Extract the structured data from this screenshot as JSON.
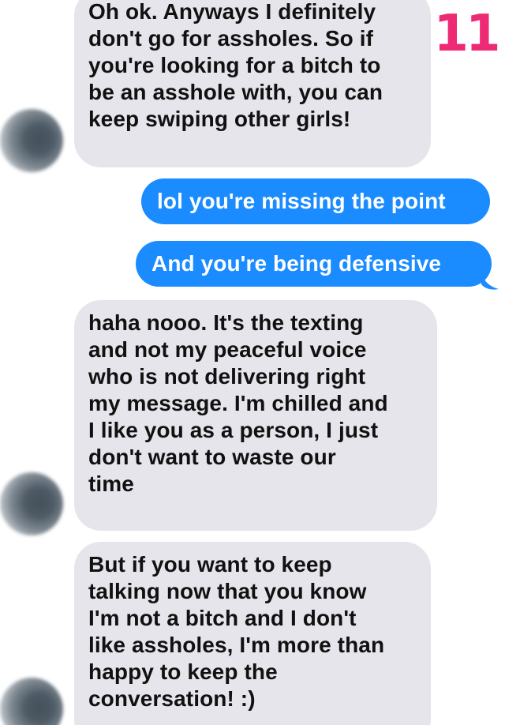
{
  "page_number": "11",
  "colors": {
    "incoming_bubble": "#e6e5eb",
    "outgoing_bubble": "#1a8cff",
    "page_number": "#ee2a74"
  },
  "messages": [
    {
      "sender": "them",
      "lines": [
        "Oh ok. Anyways I definitely",
        "don't go for assholes. So if",
        "you're looking for a bitch to",
        "be an asshole with, you can",
        "keep swiping other girls!"
      ]
    },
    {
      "sender": "me",
      "text": "lol you're missing the point"
    },
    {
      "sender": "me",
      "text": "And you're being defensive"
    },
    {
      "sender": "them",
      "lines": [
        "haha nooo. It's the texting",
        "and not my peaceful voice",
        "who is not delivering right",
        "my message. I'm chilled and",
        "I like you as a person, I just",
        "don't want to waste our",
        "time"
      ]
    },
    {
      "sender": "them",
      "lines": [
        "But if you want to keep",
        "talking now that you know",
        "I'm not a bitch and I don't",
        "like assholes, I'm more than",
        "happy to keep the",
        "conversation! :)"
      ]
    }
  ]
}
